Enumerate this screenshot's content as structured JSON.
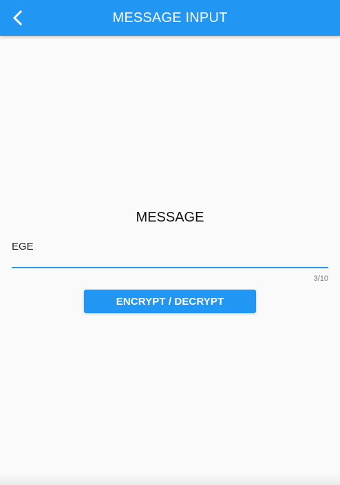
{
  "colors": {
    "accent": "#2196f3",
    "background": "#fafafa"
  },
  "app_bar": {
    "title": "MESSAGE INPUT",
    "back_icon": "chevron-left-icon"
  },
  "form": {
    "label": "MESSAGE",
    "message_value": "EGE",
    "char_counter": "3/10",
    "submit_label": "ENCRYPT / DECRYPT"
  }
}
